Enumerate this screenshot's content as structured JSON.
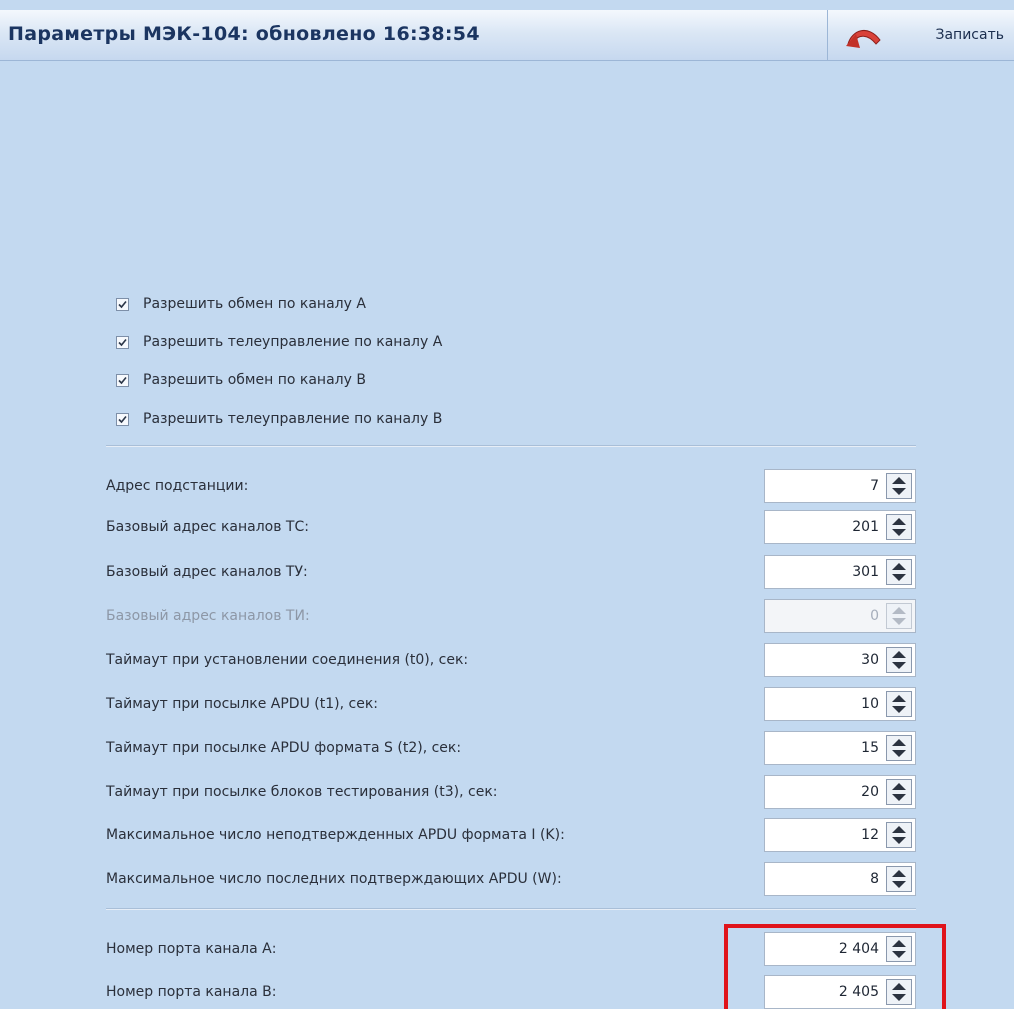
{
  "header": {
    "title": "Параметры МЭК-104: обновлено 16:38:54",
    "save_label": "Записать"
  },
  "checkboxes": [
    {
      "label": "Разрешить обмен по каналу А",
      "checked": true
    },
    {
      "label": "Разрешить телеуправление по каналу А",
      "checked": true
    },
    {
      "label": "Разрешить обмен по каналу В",
      "checked": true
    },
    {
      "label": "Разрешить телеуправление по каналу В",
      "checked": true
    }
  ],
  "fields": [
    {
      "label": "Адрес подстанции:",
      "value": "7",
      "disabled": false
    },
    {
      "label": "Базовый адрес каналов ТС:",
      "value": "201",
      "disabled": false
    },
    {
      "label": "Базовый адрес каналов ТУ:",
      "value": "301",
      "disabled": false
    },
    {
      "label": "Базовый адрес каналов ТИ:",
      "value": "0",
      "disabled": true
    },
    {
      "label": "Таймаут при установлении соединения (t0), сек:",
      "value": "30",
      "disabled": false
    },
    {
      "label": "Таймаут при посылке APDU (t1), сек:",
      "value": "10",
      "disabled": false
    },
    {
      "label": "Таймаут при посылке APDU формата S (t2), сек:",
      "value": "15",
      "disabled": false
    },
    {
      "label": "Таймаут при посылке блоков тестирования (t3), сек:",
      "value": "20",
      "disabled": false
    },
    {
      "label": "Максимальное число неподтвержденных APDU формата I (K):",
      "value": "12",
      "disabled": false
    },
    {
      "label": "Максимальное число последних подтверждающих APDU (W):",
      "value": "8",
      "disabled": false
    }
  ],
  "ports": [
    {
      "label": "Номер порта канала А:",
      "value": "2 404"
    },
    {
      "label": "Номер порта канала В:",
      "value": "2 405"
    }
  ],
  "colors": {
    "background": "#c3d9f0",
    "highlight": "#e0141b",
    "title": "#1b3561"
  }
}
